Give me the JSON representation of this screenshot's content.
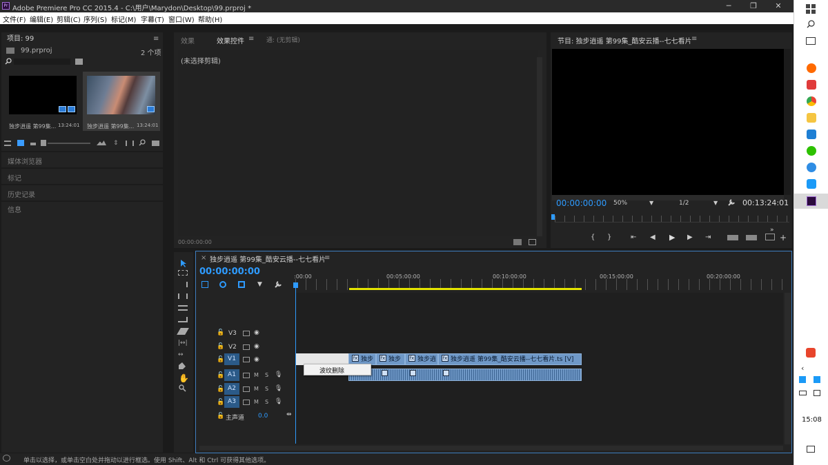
{
  "window": {
    "title": "Adobe Premiere Pro CC 2015.4 - C:\\用户\\Marydon\\Desktop\\99.prproj *",
    "logo_text": "Pr",
    "minimize": "─",
    "restore": "❐",
    "close": "✕"
  },
  "menu": [
    "文件(F)",
    "编辑(E)",
    "剪辑(C)",
    "序列(S)",
    "标记(M)",
    "字幕(T)",
    "窗口(W)",
    "帮助(H)"
  ],
  "project": {
    "title": "项目: 99",
    "file": "99.prproj",
    "count": "2 个项",
    "items": [
      {
        "name": "独步逍遥 第99集...",
        "duration": "13:24:01"
      },
      {
        "name": "独步逍遥 第99集...",
        "duration": "13:24:01"
      }
    ],
    "collapsed_panels": [
      "媒体浏览器",
      "标记",
      "历史记录",
      "信息"
    ]
  },
  "effects": {
    "tabs": [
      "效果",
      "效果控件",
      "通: (无剪辑)"
    ],
    "no_clip": "(未选择剪辑)",
    "timecode": "00:00:00:00"
  },
  "program": {
    "title": "节目: 独步逍遥 第99集_酷安云播--七七看片",
    "timecode": "00:00:00:00",
    "zoom": "50%",
    "resolution": "1/2",
    "duration": "00:13:24:01"
  },
  "timeline": {
    "title": "独步逍遥 第99集_酷安云播--七七看片",
    "timecode": "00:00:00:00",
    "ruler": [
      ":00:00",
      "00:05:00:00",
      "00:10:00:00",
      "00:15:00:00",
      "00:20:00:00"
    ],
    "tracks_video": [
      "V3",
      "V2",
      "V1"
    ],
    "tracks_audio": [
      "A1",
      "A2",
      "A3"
    ],
    "master_label": "主声道",
    "master_value": "0.0",
    "clips": [
      {
        "label": "独步"
      },
      {
        "label": "独步"
      },
      {
        "label": "独步逍"
      },
      {
        "label": "独步逍遥 第99集_酷安云播--七七看片.ts [V]"
      }
    ],
    "context_menu": "波纹删除",
    "m": "M",
    "s": "S"
  },
  "status": {
    "text": "单击以选择，或单击空白处并拖动以进行框选。使用 Shift、Alt 和 Ctrl 可获得其他选项。"
  },
  "taskbar": {
    "time": "15:08"
  },
  "colors": {
    "accent": "#2e9bff",
    "clip": "#6f98c7",
    "work_area": "#e5e500",
    "premiere": "#a06cd5"
  }
}
